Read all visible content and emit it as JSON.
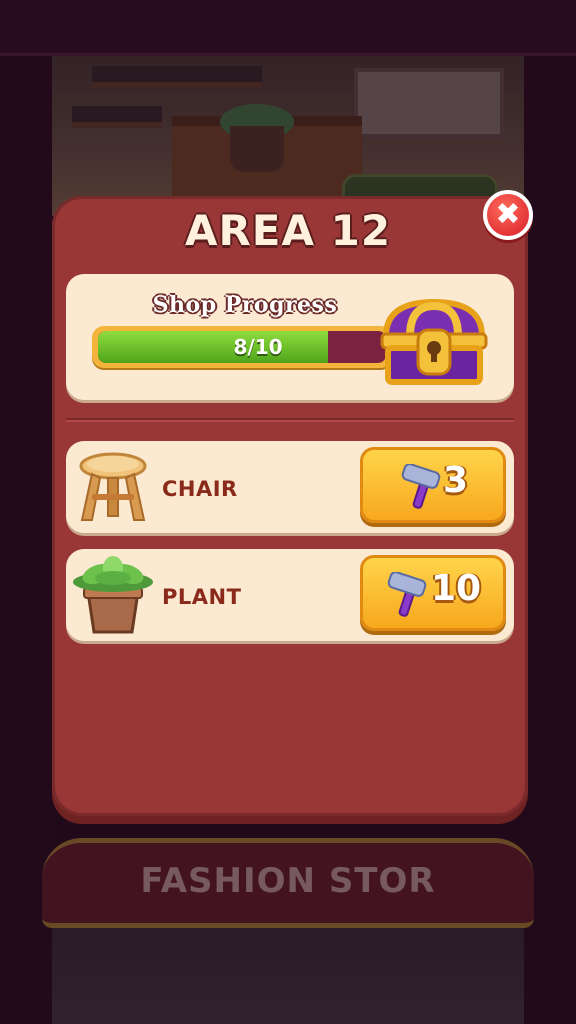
{
  "modal": {
    "title": "AREA 12",
    "close_icon": "close-icon"
  },
  "progress": {
    "label": "Shop Progress",
    "text": "8/10",
    "current": 8,
    "total": 10,
    "reward_icon": "treasure-chest-icon"
  },
  "items": [
    {
      "name": "CHAIR",
      "cost": "3",
      "icon": "stool-icon",
      "currency_icon": "hammer-icon"
    },
    {
      "name": "PLANT",
      "cost": "10",
      "icon": "potted-plant-icon",
      "currency_icon": "hammer-icon"
    }
  ],
  "background": {
    "banner_text": "FASHION STOR"
  },
  "colors": {
    "modal_bg": "#993636",
    "card_bg": "#fbe9d2",
    "progress_fill": "#6cc22a",
    "button_gold": "#f7b52a",
    "close_red": "#e0222e"
  }
}
